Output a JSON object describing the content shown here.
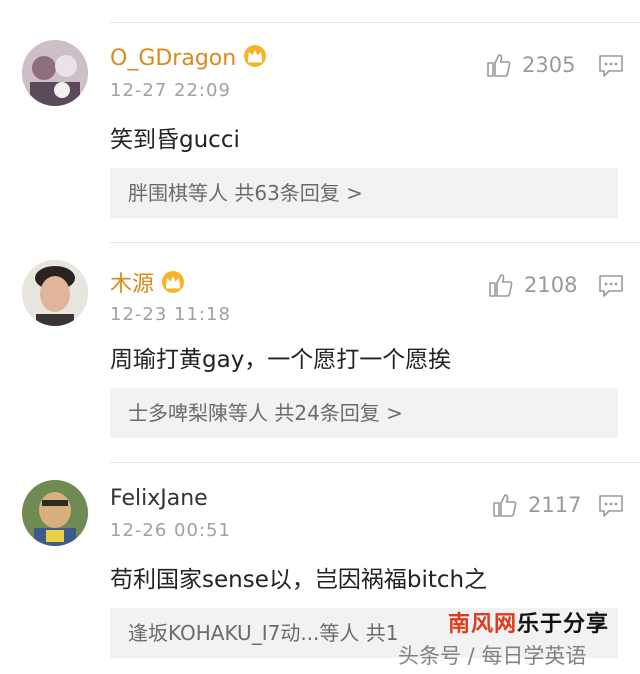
{
  "comments": [
    {
      "username": "O_GDragon",
      "vip": true,
      "time": "12-27 22:09",
      "likes": "2305",
      "text": "笑到昏gucci",
      "replies": "胖围棋等人  共63条回复 >"
    },
    {
      "username": "木源",
      "vip": true,
      "time": "12-23 11:18",
      "likes": "2108",
      "text": "周瑜打黄gay，一个愿打一个愿挨",
      "replies": "士多啤梨陳等人  共24条回复 >"
    },
    {
      "username": "FelixJane",
      "vip": false,
      "time": "12-26 00:51",
      "likes": "2117",
      "text": "苟利国家sense以，岂因祸福bitch之",
      "replies": "逢坂KOHAKU_I7动...等人  共1"
    }
  ],
  "watermark": {
    "site": "南风网",
    "sub": "乐于分享",
    "credit": "头条号 / 每日学英语"
  },
  "colors": {
    "vip_name": "#d98a1b",
    "meta_gray": "#a0a0a0",
    "reply_bg": "#f2f2f2",
    "watermark_red": "#e03a1e"
  }
}
